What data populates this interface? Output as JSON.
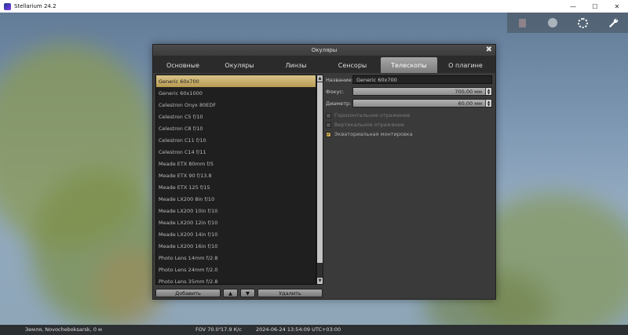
{
  "window": {
    "title": "Stellarium 24.2",
    "controls": [
      "—",
      "☐",
      "✕"
    ]
  },
  "topbar": {
    "icons": [
      "trash-icon",
      "blank-disc-icon",
      "dotted-circle-icon",
      "wrench-icon"
    ]
  },
  "dialog": {
    "title": "Окуляры",
    "close": "✖",
    "tabs": [
      "Основные",
      "Окуляры",
      "Линзы",
      "Сенсоры",
      "Телескопы",
      "О плагине"
    ],
    "active_tab": 4,
    "list": [
      "Generic 60x700",
      "Generic 60x1000",
      "Celestron Onyx 80EDF",
      "Celestron C5 f/10",
      "Celestron C8 f/10",
      "Celestron C11 f/10",
      "Celestron C14 f/11",
      "Meade ETX 80mm f/5",
      "Meade ETX 90 f/13.8",
      "Meade ETX 125 f/15",
      "Meade LX200 8in f/10",
      "Meade  LX200 10in f/10",
      "Meade  LX200 12in f/10",
      "Meade  LX200 14in f/10",
      "Meade  LX200 16in f/10",
      "Photo Lens 14mm f/2.8",
      "Photo Lens 24mm f/2.0",
      "Photo Lens 35mm f/2.8"
    ],
    "buttons": {
      "add": "Добавить",
      "up": "▲",
      "down": "▼",
      "delete": "Удалить"
    },
    "form": {
      "name_label": "Название:",
      "name_value": "Generic 60x700",
      "focus_label": "Фокус:",
      "focus_value": "700,00 мм",
      "diameter_label": "Диаметр:",
      "diameter_value": "60,00 мм",
      "spin_up": "▲",
      "spin_down": "▼",
      "checkboxes": [
        {
          "label": "Горизонтальное отражение",
          "checked": false
        },
        {
          "label": "Вертикальное отражение",
          "checked": false
        },
        {
          "label": "Экваториальная монтировка",
          "checked": true
        }
      ],
      "check_mark": "✓"
    }
  },
  "statusbar": {
    "location": "Земля, Novocheboksarsk, 0 м",
    "fov": "FOV 70.0°",
    "fps": "17.9 К/с",
    "datetime": "2024-06-24 13:54:09 UTC+03:00"
  },
  "colors": {
    "accent": "#c9a852",
    "dialog_bg": "#3a3a3a",
    "list_bg": "#1f1f1f"
  }
}
